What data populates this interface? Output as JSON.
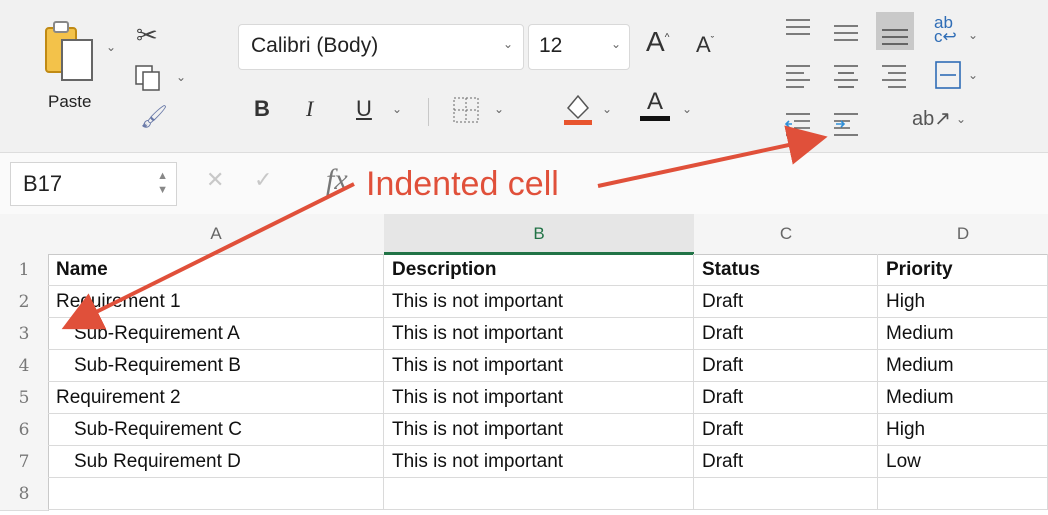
{
  "ribbon": {
    "paste_label": "Paste",
    "font_name": "Calibri (Body)",
    "font_size": "12",
    "grow_font_glyph": "A",
    "shrink_font_glyph": "A",
    "bold_glyph": "B",
    "italic_glyph": "I",
    "underline_glyph": "U",
    "font_color_glyph": "A",
    "wrap_glyph": "ab"
  },
  "formula_bar": {
    "name_box": "B17",
    "fx_label": "fx"
  },
  "annotation": {
    "label": "Indented cell",
    "color": "#e0503a"
  },
  "sheet": {
    "columns": [
      "A",
      "B",
      "C",
      "D"
    ],
    "rows": [
      {
        "num": "1",
        "cells": [
          "Name",
          "Description",
          "Status",
          "Priority"
        ],
        "header": true
      },
      {
        "num": "2",
        "cells": [
          "Requirement 1",
          "This is not important",
          "Draft",
          "High"
        ]
      },
      {
        "num": "3",
        "cells": [
          "Sub-Requirement A",
          "This is not important",
          "Draft",
          "Medium"
        ],
        "indent": true
      },
      {
        "num": "4",
        "cells": [
          "Sub-Requirement B",
          "This is not important",
          "Draft",
          "Medium"
        ],
        "indent": true
      },
      {
        "num": "5",
        "cells": [
          "Requirement 2",
          "This is not important",
          "Draft",
          "Medium"
        ]
      },
      {
        "num": "6",
        "cells": [
          "Sub-Requirement C",
          "This is not important",
          "Draft",
          "High"
        ],
        "indent": true
      },
      {
        "num": "7",
        "cells": [
          "Sub Requirement D",
          "This is not important",
          "Draft",
          "Low"
        ],
        "indent": true
      },
      {
        "num": "8",
        "cells": [
          "",
          "",
          "",
          ""
        ]
      }
    ]
  }
}
